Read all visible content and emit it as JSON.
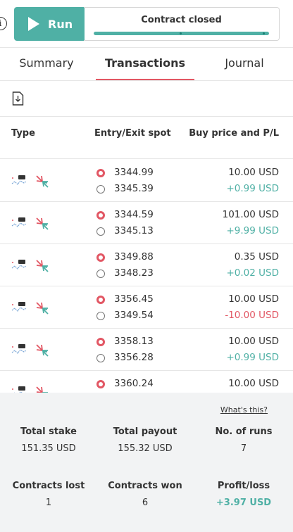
{
  "topbar": {
    "info_icon": "i",
    "run_label": "Run",
    "status": "Contract closed",
    "progress": 1.0
  },
  "tabs": [
    {
      "label": "Summary",
      "active": false
    },
    {
      "label": "Transactions",
      "active": true
    },
    {
      "label": "Journal",
      "active": false
    }
  ],
  "toolbar": {
    "download_icon": "download-icon"
  },
  "table": {
    "headers": [
      "Type",
      "Entry/Exit spot",
      "Buy price and P/L"
    ],
    "rows": [
      {
        "entry": "3344.99",
        "exit": "3345.39",
        "buy": "10.00 USD",
        "pl": "+0.99 USD",
        "pl_sign": "pos"
      },
      {
        "entry": "3344.59",
        "exit": "3345.13",
        "buy": "101.00 USD",
        "pl": "+9.99 USD",
        "pl_sign": "pos"
      },
      {
        "entry": "3349.88",
        "exit": "3348.23",
        "buy": "0.35 USD",
        "pl": "+0.02 USD",
        "pl_sign": "pos"
      },
      {
        "entry": "3356.45",
        "exit": "3349.54",
        "buy": "10.00 USD",
        "pl": "-10.00 USD",
        "pl_sign": "neg"
      },
      {
        "entry": "3358.13",
        "exit": "3356.28",
        "buy": "10.00 USD",
        "pl": "+0.99 USD",
        "pl_sign": "pos"
      },
      {
        "entry": "3360.24",
        "exit": "",
        "buy": "10.00 USD",
        "pl": "",
        "pl_sign": "pos"
      }
    ]
  },
  "summary": {
    "whats_this": "What's this?",
    "total_stake_label": "Total stake",
    "total_stake": "151.35 USD",
    "total_payout_label": "Total payout",
    "total_payout": "155.32 USD",
    "runs_label": "No. of runs",
    "runs": "7",
    "lost_label": "Contracts lost",
    "lost": "1",
    "won_label": "Contracts won",
    "won": "6",
    "profit_label": "Profit/loss",
    "profit": "+3.97 USD"
  },
  "colors": {
    "accent": "#4fb0a5",
    "loss": "#e25764",
    "panel": "#f2f3f4"
  }
}
